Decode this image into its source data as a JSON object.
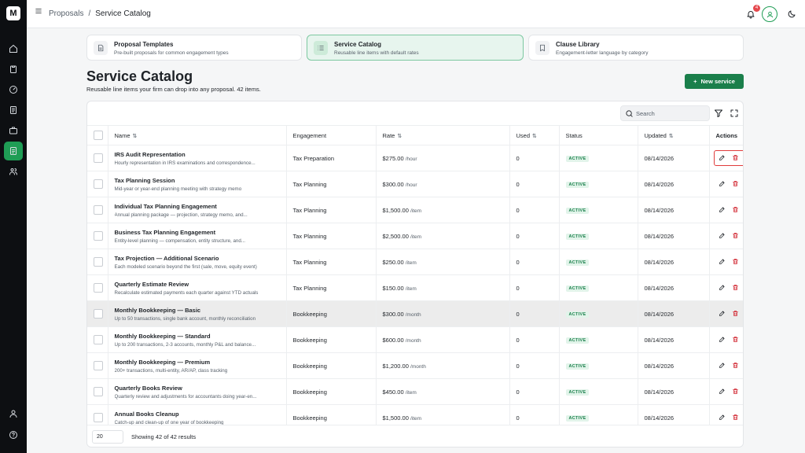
{
  "rail": {
    "logo": "M"
  },
  "topbar": {
    "breadcrumb": [
      "Proposals",
      "/",
      "Service Catalog"
    ],
    "notifications_count": "4"
  },
  "cards": [
    {
      "title": "Proposal Templates",
      "subtitle": "Pre-built proposals for common engagement types",
      "icon": "document-icon",
      "active": false
    },
    {
      "title": "Service Catalog",
      "subtitle": "Reusable line items with default rates",
      "icon": "list-icon",
      "active": true
    },
    {
      "title": "Clause Library",
      "subtitle": "Engagement-letter language by category",
      "icon": "bookmark-icon",
      "active": false
    }
  ],
  "page": {
    "title": "Service Catalog",
    "subtitle": "Reusable line items your firm can drop into any proposal. 42 items.",
    "new_button": "New service"
  },
  "search": {
    "placeholder": "Search"
  },
  "table": {
    "columns": [
      "Name",
      "Engagement",
      "Rate",
      "Used",
      "Status",
      "Updated",
      "Actions"
    ],
    "sortable": [
      "Name",
      "Rate",
      "Used",
      "Updated"
    ],
    "rows": [
      {
        "name": "IRS Audit Representation",
        "desc": "Hourly representation in IRS examinations and correspondence...",
        "engagement": "Tax Preparation",
        "rate": "$275.00",
        "unit": "/hour",
        "used": "0",
        "status": "ACTIVE",
        "updated": "08/14/2026"
      },
      {
        "name": "Tax Planning Session",
        "desc": "Mid-year or year-end planning meeting with strategy memo",
        "engagement": "Tax Planning",
        "rate": "$300.00",
        "unit": "/hour",
        "used": "0",
        "status": "ACTIVE",
        "updated": "08/14/2026"
      },
      {
        "name": "Individual Tax Planning Engagement",
        "desc": "Annual planning package — projection, strategy memo, and...",
        "engagement": "Tax Planning",
        "rate": "$1,500.00",
        "unit": "/item",
        "used": "0",
        "status": "ACTIVE",
        "updated": "08/14/2026"
      },
      {
        "name": "Business Tax Planning Engagement",
        "desc": "Entity-level planning — compensation, entity structure, and...",
        "engagement": "Tax Planning",
        "rate": "$2,500.00",
        "unit": "/item",
        "used": "0",
        "status": "ACTIVE",
        "updated": "08/14/2026"
      },
      {
        "name": "Tax Projection — Additional Scenario",
        "desc": "Each modeled scenario beyond the first (sale, move, equity event)",
        "engagement": "Tax Planning",
        "rate": "$250.00",
        "unit": "/item",
        "used": "0",
        "status": "ACTIVE",
        "updated": "08/14/2026"
      },
      {
        "name": "Quarterly Estimate Review",
        "desc": "Recalculate estimated payments each quarter against YTD actuals",
        "engagement": "Tax Planning",
        "rate": "$150.00",
        "unit": "/item",
        "used": "0",
        "status": "ACTIVE",
        "updated": "08/14/2026"
      },
      {
        "name": "Monthly Bookkeeping — Basic",
        "desc": "Up to 50 transactions, single bank account, monthly reconciliation",
        "engagement": "Bookkeeping",
        "rate": "$300.00",
        "unit": "/month",
        "used": "0",
        "status": "ACTIVE",
        "updated": "08/14/2026"
      },
      {
        "name": "Monthly Bookkeeping — Standard",
        "desc": "Up to 200 transactions, 2-3 accounts, monthly P&L and balance...",
        "engagement": "Bookkeeping",
        "rate": "$600.00",
        "unit": "/month",
        "used": "0",
        "status": "ACTIVE",
        "updated": "08/14/2026"
      },
      {
        "name": "Monthly Bookkeeping — Premium",
        "desc": "200+ transactions, multi-entity, AR/AP, class tracking",
        "engagement": "Bookkeeping",
        "rate": "$1,200.00",
        "unit": "/month",
        "used": "0",
        "status": "ACTIVE",
        "updated": "08/14/2026"
      },
      {
        "name": "Quarterly Books Review",
        "desc": "Quarterly review and adjustments for accountants doing year-en...",
        "engagement": "Bookkeeping",
        "rate": "$450.00",
        "unit": "/item",
        "used": "0",
        "status": "ACTIVE",
        "updated": "08/14/2026"
      },
      {
        "name": "Annual Books Cleanup",
        "desc": "Catch-up and clean-up of one year of bookkeeping",
        "engagement": "Bookkeeping",
        "rate": "$1,500.00",
        "unit": "/item",
        "used": "0",
        "status": "ACTIVE",
        "updated": "08/14/2026"
      }
    ]
  },
  "footer": {
    "page_size": "20",
    "showing": "Showing 42 of 42 results"
  },
  "colors": {
    "brand": "#1a7f4b",
    "rail": "#0d0f12",
    "danger": "#d1242f"
  }
}
